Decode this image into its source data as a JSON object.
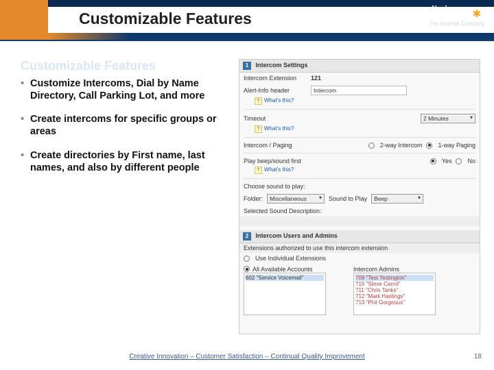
{
  "title": "Customizable Features",
  "subtitle": "Customizable Features",
  "logo": {
    "name": "digium",
    "sub": "The Asterisk Company"
  },
  "bullets": [
    "Customize Intercoms, Dial by Name Directory, Call Parking Lot, and more",
    "Create intercoms for specific groups or areas",
    "Create directories by First name, last names, and also by different people"
  ],
  "panel": {
    "sec1": {
      "num": "1",
      "title": "Intercom Settings",
      "ext_lbl": "Intercom Extension",
      "ext_val": "121",
      "alert_lbl": "Alert-Info header",
      "alert_val": "Intercom",
      "help": "What's this?",
      "timeout_lbl": "Timeout",
      "timeout_val": "2 Minutes",
      "mode_lbl": "Intercom / Paging",
      "mode_opts": [
        "2-way Intercom",
        "1-way Paging"
      ],
      "beep_lbl": "Play beep/sound first",
      "beep_opts": [
        "Yes",
        "No"
      ],
      "choose_sound": "Choose sound to play:",
      "folder_lbl": "Folder:",
      "folder_val": "Miscellaneous",
      "sound_lbl": "Sound to Play",
      "sound_val": "Beep",
      "desc_lbl": "Selected Sound Description:"
    },
    "sec2": {
      "num": "2",
      "title": "Intercom Users and Admins",
      "auth": "Extensions authorized to use this intercom extension",
      "opt1": "Use Individual Extensions",
      "opt2": "All Available Accounts",
      "left_list": [
        "602 \"Service Voicemail\""
      ],
      "right_hdr": "Intercom Admins",
      "right_list": [
        "709 \"Test Testington\"",
        "710 \"Steve Carrol\"",
        "711 \"Chris Tanks\"",
        "712 \"Mark Hastings\"",
        "713 \"Phil Gorgeous\""
      ]
    }
  },
  "footer": "Creative Innovation – Customer Satisfaction – Continual Quality Improvement",
  "page": "18"
}
